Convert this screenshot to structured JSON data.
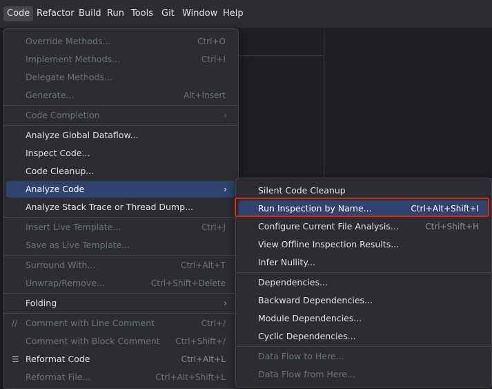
{
  "menubar": [
    {
      "label": "Code",
      "active": true
    },
    {
      "label": "Refactor"
    },
    {
      "label": "Build"
    },
    {
      "label": "Run"
    },
    {
      "label": "Tools"
    },
    {
      "label": "Git"
    },
    {
      "label": "Window"
    },
    {
      "label": "Help"
    }
  ],
  "code_menu": {
    "override_methods": {
      "label": "Override Methods...",
      "shortcut": "Ctrl+O"
    },
    "implement_methods": {
      "label": "Implement Methods...",
      "shortcut": "Ctrl+I"
    },
    "delegate_methods": {
      "label": "Delegate Methods..."
    },
    "generate": {
      "label": "Generate...",
      "shortcut": "Alt+Insert"
    },
    "code_completion": {
      "label": "Code Completion"
    },
    "analyze_global_dataflow": {
      "label": "Analyze Global Dataflow..."
    },
    "inspect_code": {
      "label": "Inspect Code..."
    },
    "code_cleanup": {
      "label": "Code Cleanup..."
    },
    "analyze_code": {
      "label": "Analyze Code"
    },
    "analyze_stack_trace": {
      "label": "Analyze Stack Trace or Thread Dump..."
    },
    "insert_live_template": {
      "label": "Insert Live Template...",
      "shortcut": "Ctrl+J"
    },
    "save_as_live_template": {
      "label": "Save as Live Template..."
    },
    "surround_with": {
      "label": "Surround With...",
      "shortcut": "Ctrl+Alt+T"
    },
    "unwrap_remove": {
      "label": "Unwrap/Remove...",
      "shortcut": "Ctrl+Shift+Delete"
    },
    "folding": {
      "label": "Folding"
    },
    "comment_line": {
      "label": "Comment with Line Comment",
      "shortcut": "Ctrl+/",
      "icon": "//"
    },
    "comment_block": {
      "label": "Comment with Block Comment",
      "shortcut": "Ctrl+Shift+/"
    },
    "reformat_code": {
      "label": "Reformat Code",
      "shortcut": "Ctrl+Alt+L",
      "icon": "☰"
    },
    "reformat_file": {
      "label": "Reformat File...",
      "shortcut": "Ctrl+Alt+Shift+L"
    }
  },
  "analyze_submenu": {
    "silent_code_cleanup": {
      "label": "Silent Code Cleanup"
    },
    "run_inspection_by_name": {
      "label": "Run Inspection by Name...",
      "shortcut": "Ctrl+Alt+Shift+I"
    },
    "configure_current_file": {
      "label": "Configure Current File Analysis...",
      "shortcut": "Ctrl+Shift+H"
    },
    "view_offline": {
      "label": "View Offline Inspection Results..."
    },
    "infer_nullity": {
      "label": "Infer Nullity..."
    },
    "dependencies": {
      "label": "Dependencies..."
    },
    "backward_dependencies": {
      "label": "Backward Dependencies..."
    },
    "module_dependencies": {
      "label": "Module Dependencies..."
    },
    "cyclic_dependencies": {
      "label": "Cyclic Dependencies..."
    },
    "data_flow_to_here": {
      "label": "Data Flow to Here..."
    },
    "data_flow_from_here": {
      "label": "Data Flow from Here..."
    }
  },
  "icons": {
    "submenu_arrow": "›"
  },
  "colors": {
    "selection": "#2e436e",
    "highlight_box": "#e2231a"
  }
}
